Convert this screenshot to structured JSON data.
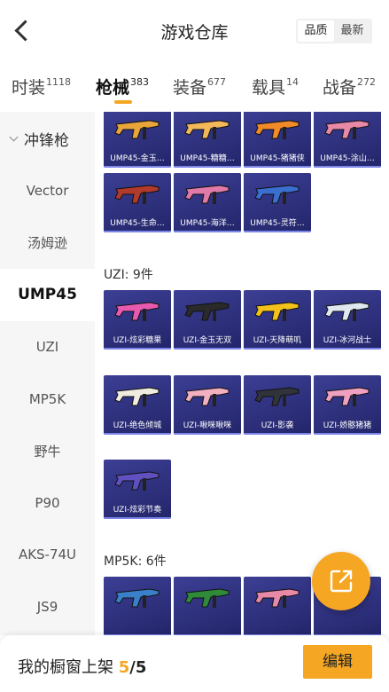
{
  "header": {
    "title": "游戏仓库",
    "sort_options": [
      "品质",
      "最新"
    ],
    "sort_active": 0
  },
  "tabs": [
    {
      "label": "时装",
      "count": "1118"
    },
    {
      "label": "枪械",
      "count": "383"
    },
    {
      "label": "装备",
      "count": "677"
    },
    {
      "label": "载具",
      "count": "14"
    },
    {
      "label": "战备",
      "count": "272"
    }
  ],
  "sidebar": {
    "group": "冲锋枪",
    "items": [
      "Vector",
      "汤姆逊",
      "UMP45",
      "UZI",
      "MP5K",
      "野牛",
      "P90",
      "AKS-74U",
      "JS9"
    ],
    "active": 2
  },
  "sections": {
    "ump45": {
      "items": [
        "UMP45-金玉…",
        "UMP45-糖糖…",
        "UMP45-猪猪侠",
        "UMP45-涂山…",
        "UMP45-生命…",
        "UMP45-海洋…",
        "UMP45-灵符…"
      ]
    },
    "uzi": {
      "label": "UZI: 9件",
      "items": [
        "UZI-炫彩糖果",
        "UZI-金玉无双",
        "UZI-天降萌叽",
        "UZI-冰河战士",
        "UZI-绝色倾城",
        "UZI-啾咪啾咪",
        "UZI-影袭",
        "UZI-娇憨猪猪",
        "UZI-炫彩节奏"
      ]
    },
    "mp5k": {
      "label": "MP5K: 6件"
    }
  },
  "footer": {
    "label": "我的橱窗上架 ",
    "count": "5",
    "sep": "/",
    "total": "5",
    "edit_label": "编辑"
  },
  "colors": {
    "accent": "#f5a623",
    "card_bg": "#2e3080"
  }
}
